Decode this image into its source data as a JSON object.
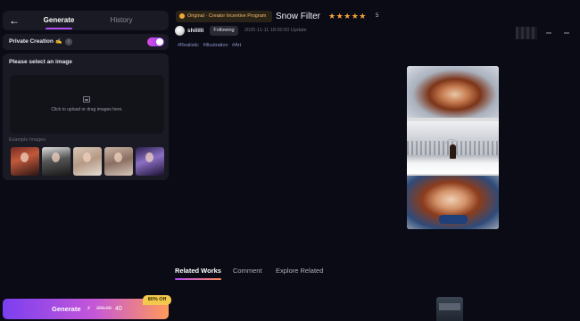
{
  "left_panel": {
    "tabs": {
      "generate": "Generate",
      "history": "History"
    },
    "private_creation": {
      "label": "Private Creation",
      "emoji": "✍️",
      "info": "i",
      "enabled": true
    },
    "upload_section": {
      "title": "Please select an image",
      "upload_text": "Click to upload or drag images here.",
      "examples_label": "Example Images",
      "examples_count": 5
    },
    "generate_button": {
      "label": "Generate",
      "icon": "⚡",
      "old_price": "200.00",
      "new_price": "40",
      "discount_badge": "80% Off"
    }
  },
  "header": {
    "badge": "Original · Creator Incentive Program",
    "title": "Snow Filter",
    "stars": "★★★★★",
    "rating_count": "5",
    "author": "shililli",
    "follow_button": "Following",
    "timestamp": "2025-11-11 18:00:50 Update"
  },
  "tags": [
    "#Realistic",
    "#Illustration",
    "#Art"
  ],
  "bottom_tabs": {
    "related": "Related Works",
    "comment": "Comment",
    "explore": "Explore Related"
  },
  "colors": {
    "background": "#0b0b16",
    "panel": "#1a1a24",
    "accent_purple": "#b14cf0",
    "accent_orange": "#ff9a5a",
    "star": "#f5a23a"
  },
  "icons": [
    "back-arrow-icon",
    "info-icon",
    "image-upload-icon",
    "bolt-icon",
    "star-icon",
    "avatar"
  ]
}
